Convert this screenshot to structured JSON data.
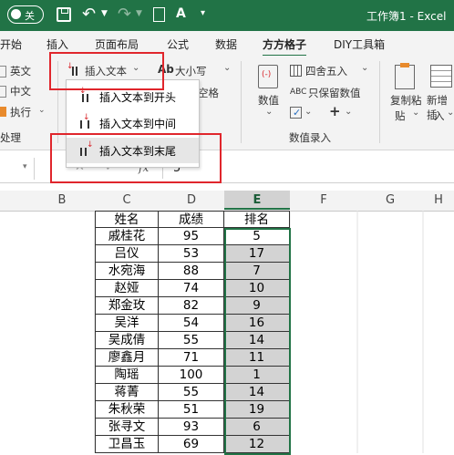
{
  "titlebar": {
    "autosave_label": "关",
    "title": "工作簿1",
    "separator": "-",
    "app": "Excel"
  },
  "tabs": [
    "开始",
    "插入",
    "页面布局",
    "公式",
    "数据",
    "方方格子",
    "DIY工具箱"
  ],
  "active_tab": "方方格子",
  "ribbon": {
    "left_items": [
      "英文",
      "中文",
      "执行"
    ],
    "left_group_label": "处理",
    "insert_text_button": "插入文本",
    "case_button": "大小写",
    "space_button": "空格",
    "round_button": "四舍五入",
    "keep_value_button": "只保留数值",
    "numeric_button": "数值",
    "plus_button": "+",
    "group_label_numeric": "数值录入",
    "copy_paste_button": [
      "复制粘",
      "贴"
    ],
    "new_insert_button": [
      "新增插",
      "入"
    ]
  },
  "dropdown_menu": [
    {
      "label": "插入文本到开头"
    },
    {
      "label": "插入文本到中间"
    },
    {
      "label": "插入文本到末尾"
    }
  ],
  "formula_bar": {
    "fx": "fx",
    "value": "5"
  },
  "column_headers": [
    "B",
    "C",
    "D",
    "E",
    "F",
    "G",
    "H"
  ],
  "table": {
    "headers": [
      "姓名",
      "成绩",
      "排名"
    ],
    "rows": [
      [
        "戚桂花",
        "95",
        "5"
      ],
      [
        "吕仪",
        "53",
        "17"
      ],
      [
        "水宛海",
        "88",
        "7"
      ],
      [
        "赵娅",
        "74",
        "10"
      ],
      [
        "郑金玫",
        "82",
        "9"
      ],
      [
        "吴洋",
        "54",
        "16"
      ],
      [
        "吴成倩",
        "55",
        "14"
      ],
      [
        "廖鑫月",
        "71",
        "11"
      ],
      [
        "陶瑶",
        "100",
        "1"
      ],
      [
        "蒋菁",
        "55",
        "14"
      ],
      [
        "朱秋荣",
        "51",
        "19"
      ],
      [
        "张寻文",
        "93",
        "6"
      ],
      [
        "卫昌玉",
        "69",
        "12"
      ]
    ]
  },
  "colors": {
    "excel_green": "#217346",
    "highlight_red": "#e0262c",
    "selection_gray": "#d3d3d3"
  }
}
